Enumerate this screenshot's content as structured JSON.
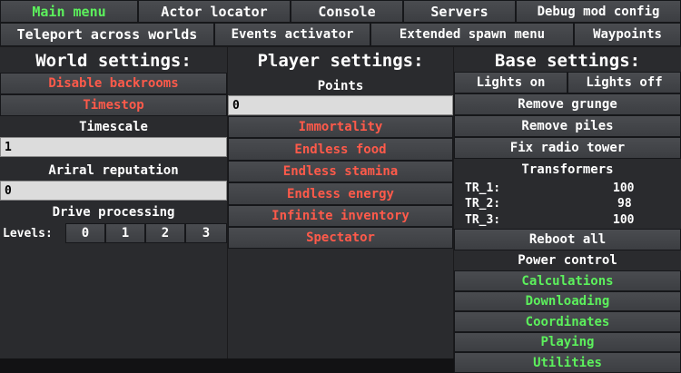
{
  "top_tabs": {
    "main_menu": "Main menu",
    "actor_locator": "Actor locator",
    "console": "Console",
    "servers": "Servers",
    "debug_mod_config": "Debug mod config",
    "teleport": "Teleport across worlds",
    "events_activator": "Events activator",
    "extended_spawn": "Extended spawn menu",
    "waypoints": "Waypoints"
  },
  "world": {
    "title": "World settings:",
    "disable_backrooms": "Disable backrooms",
    "timestop": "Timestop",
    "timescale_label": "Timescale",
    "timescale_value": "1",
    "reputation_label": "Ariral reputation",
    "reputation_value": "0",
    "drive_label": "Drive processing",
    "levels_label": "Levels:",
    "levels": [
      "0",
      "1",
      "2",
      "3"
    ]
  },
  "player": {
    "title": "Player settings:",
    "points_label": "Points",
    "points_value": "0",
    "immortality": "Immortality",
    "endless_food": "Endless food",
    "endless_stamina": "Endless stamina",
    "endless_energy": "Endless energy",
    "infinite_inventory": "Infinite inventory",
    "spectator": "Spectator"
  },
  "base": {
    "title": "Base settings:",
    "lights_on": "Lights on",
    "lights_off": "Lights off",
    "remove_grunge": "Remove grunge",
    "remove_piles": "Remove piles",
    "fix_radio": "Fix radio tower",
    "transformers_label": "Transformers",
    "transformers": [
      {
        "name": "TR_1:",
        "value": "100"
      },
      {
        "name": "TR_2:",
        "value": "98"
      },
      {
        "name": "TR_3:",
        "value": "100"
      }
    ],
    "reboot_all": "Reboot all",
    "power_control": "Power control",
    "calculations": "Calculations",
    "downloading": "Downloading",
    "coordinates": "Coordinates",
    "playing": "Playing",
    "utilities": "Utilities"
  },
  "colors": {
    "active_tab": "#5cf05c",
    "toggle_off": "#ff5a4a",
    "toggle_on": "#5cf05c",
    "button_bg": "#45474b",
    "panel_bg": "#2a2b2e"
  }
}
